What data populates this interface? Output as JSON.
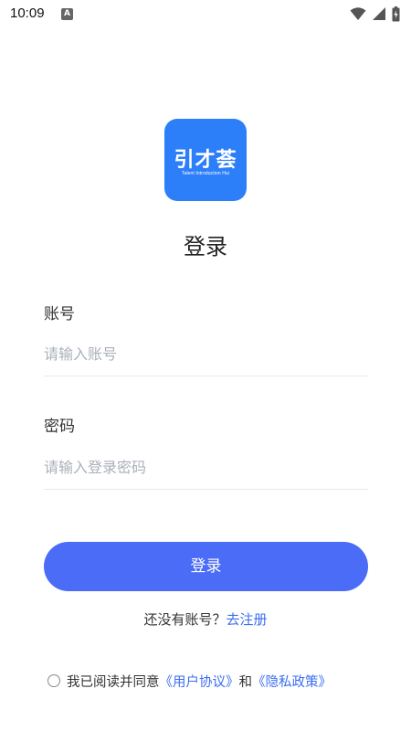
{
  "status_bar": {
    "time": "10:09",
    "notification_icon": "A"
  },
  "logo": {
    "title_cn": "引才荟",
    "subtitle_en": "Talent Introduction Hui",
    "color": "#2d7ff9"
  },
  "page": {
    "title": "登录"
  },
  "form": {
    "account_label": "账号",
    "account_placeholder": "请输入账号",
    "password_label": "密码",
    "password_placeholder": "请输入登录密码"
  },
  "actions": {
    "login_label": "登录",
    "login_color": "#4a6cf7",
    "no_account_text": "还没有账号？",
    "register_link": "去注册"
  },
  "agreement": {
    "prefix": "我已阅读并同意",
    "user_agreement": "《用户协议》",
    "and": "和",
    "privacy_policy": "《隐私政策》",
    "checked": false
  }
}
